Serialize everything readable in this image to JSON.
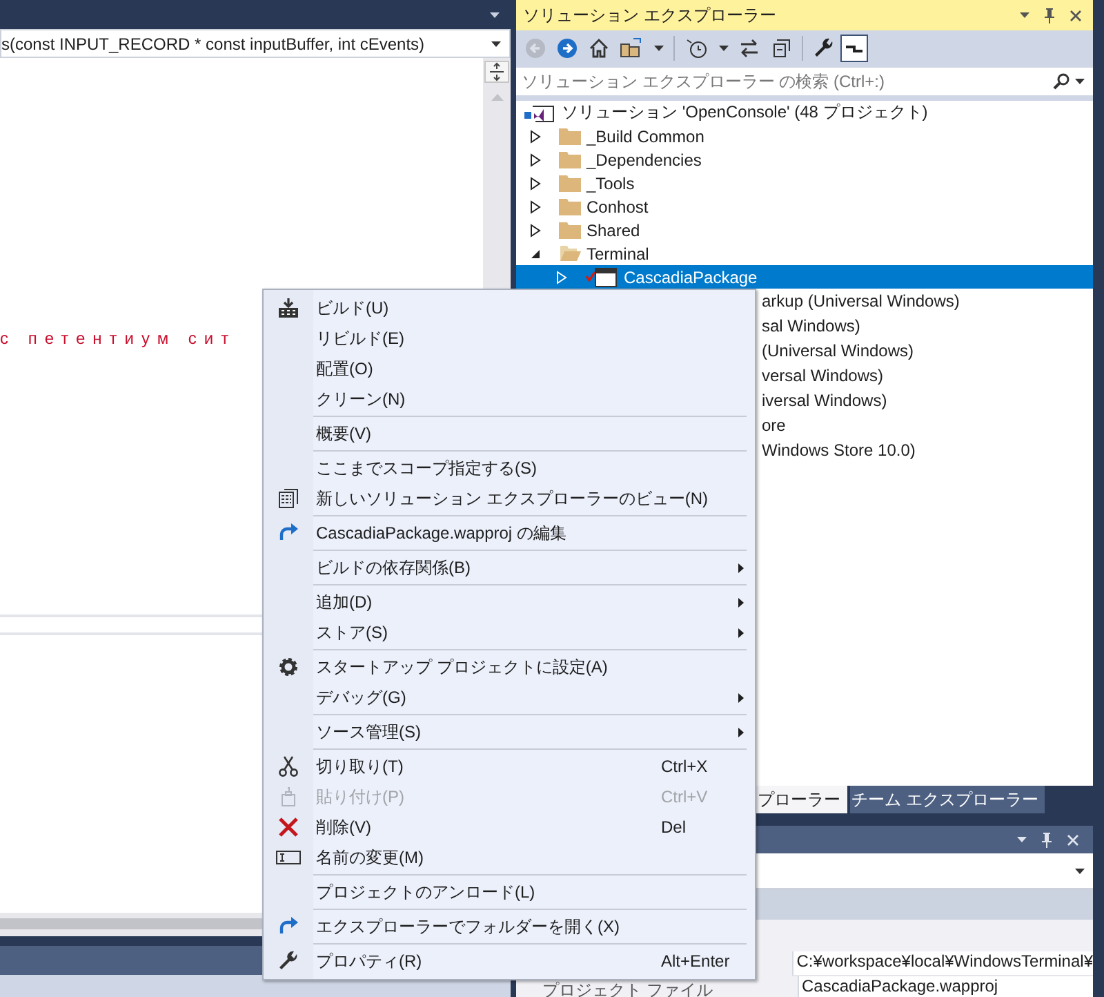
{
  "editor": {
    "nav_dropdown": "s(const INPUT_RECORD * const inputBuffer, int cEvents)",
    "code_text": "с петентиум сит"
  },
  "solution_explorer": {
    "title": "ソリューション エクスプローラー",
    "toolbar": {
      "preview_pressed": true
    },
    "search": {
      "placeholder": "ソリューション エクスプローラー の検索 (Ctrl+:)"
    },
    "tree": [
      {
        "kind": "solution",
        "label": "ソリューション 'OpenConsole' (48 プロジェクト)",
        "selected": false,
        "children": [
          {
            "kind": "folder",
            "label": "_Build Common",
            "expanded": false,
            "selected": false
          },
          {
            "kind": "folder",
            "label": "_Dependencies",
            "expanded": false,
            "selected": false
          },
          {
            "kind": "folder",
            "label": "_Tools",
            "expanded": false,
            "selected": false
          },
          {
            "kind": "folder",
            "label": "Conhost",
            "expanded": false,
            "selected": false
          },
          {
            "kind": "folder",
            "label": "Shared",
            "expanded": false,
            "selected": false
          },
          {
            "kind": "folder",
            "label": "Terminal",
            "expanded": true,
            "selected": false,
            "children": [
              {
                "kind": "project",
                "label": "CascadiaPackage",
                "expanded": false,
                "selected": true
              },
              {
                "kind": "covered",
                "label": "arkup (Universal Windows)",
                "selected": false
              },
              {
                "kind": "covered",
                "label": "sal Windows)",
                "selected": false
              },
              {
                "kind": "covered",
                "label": "(Universal Windows)",
                "selected": false
              },
              {
                "kind": "covered",
                "label": "versal Windows)",
                "selected": false
              },
              {
                "kind": "covered",
                "label": "iversal Windows)",
                "selected": false
              },
              {
                "kind": "covered",
                "label": "ore",
                "selected": false
              },
              {
                "kind": "covered",
                "label": "Windows Store 10.0)",
                "selected": false
              }
            ]
          }
        ]
      }
    ]
  },
  "tabs": [
    {
      "label": "プローラー",
      "selected": true
    },
    {
      "label": "チーム エクスプローラー",
      "selected": false
    }
  ],
  "properties": {
    "rows": [
      {
        "value": "C:¥workspace¥local¥WindowsTerminal¥"
      },
      {
        "name": "プロジェクト ファイル",
        "value": "CascadiaPackage.wapproj"
      }
    ]
  },
  "context_menu": {
    "items": [
      {
        "kind": "item",
        "label": "ビルド(U)",
        "submenu": false,
        "disabled": false
      },
      {
        "kind": "item",
        "label": "リビルド(E)",
        "submenu": false,
        "disabled": false
      },
      {
        "kind": "item",
        "label": "配置(O)",
        "submenu": false,
        "disabled": false
      },
      {
        "kind": "item",
        "label": "クリーン(N)",
        "submenu": false,
        "disabled": false
      },
      {
        "kind": "separator"
      },
      {
        "kind": "item",
        "label": "概要(V)",
        "submenu": false,
        "disabled": false
      },
      {
        "kind": "separator"
      },
      {
        "kind": "item",
        "label": "ここまでスコープ指定する(S)",
        "submenu": false,
        "disabled": false
      },
      {
        "kind": "item",
        "label": "新しいソリューション エクスプローラーのビュー(N)",
        "submenu": false,
        "disabled": false
      },
      {
        "kind": "separator"
      },
      {
        "kind": "item",
        "label": "CascadiaPackage.wapproj の編集",
        "submenu": false,
        "disabled": false
      },
      {
        "kind": "separator"
      },
      {
        "kind": "item",
        "label": "ビルドの依存関係(B)",
        "submenu": true,
        "disabled": false
      },
      {
        "kind": "separator"
      },
      {
        "kind": "item",
        "label": "追加(D)",
        "submenu": true,
        "disabled": false
      },
      {
        "kind": "item",
        "label": "ストア(S)",
        "submenu": true,
        "disabled": false
      },
      {
        "kind": "separator"
      },
      {
        "kind": "item",
        "label": "スタートアップ プロジェクトに設定(A)",
        "submenu": false,
        "disabled": false
      },
      {
        "kind": "item",
        "label": "デバッグ(G)",
        "submenu": true,
        "disabled": false
      },
      {
        "kind": "separator"
      },
      {
        "kind": "item",
        "label": "ソース管理(S)",
        "submenu": true,
        "disabled": false
      },
      {
        "kind": "separator"
      },
      {
        "kind": "item",
        "label": "切り取り(T)",
        "shortcut": "Ctrl+X",
        "submenu": false,
        "disabled": false
      },
      {
        "kind": "item",
        "label": "貼り付け(P)",
        "shortcut": "Ctrl+V",
        "submenu": false,
        "disabled": true
      },
      {
        "kind": "item",
        "label": "削除(V)",
        "shortcut": "Del",
        "submenu": false,
        "disabled": false
      },
      {
        "kind": "item",
        "label": "名前の変更(M)",
        "submenu": false,
        "disabled": false
      },
      {
        "kind": "separator"
      },
      {
        "kind": "item",
        "label": "プロジェクトのアンロード(L)",
        "submenu": false,
        "disabled": false
      },
      {
        "kind": "separator"
      },
      {
        "kind": "item",
        "label": "エクスプローラーでフォルダーを開く(X)",
        "submenu": false,
        "disabled": false
      },
      {
        "kind": "separator"
      },
      {
        "kind": "item",
        "label": "プロパティ(R)",
        "shortcut": "Alt+Enter",
        "submenu": false,
        "disabled": false
      }
    ]
  }
}
